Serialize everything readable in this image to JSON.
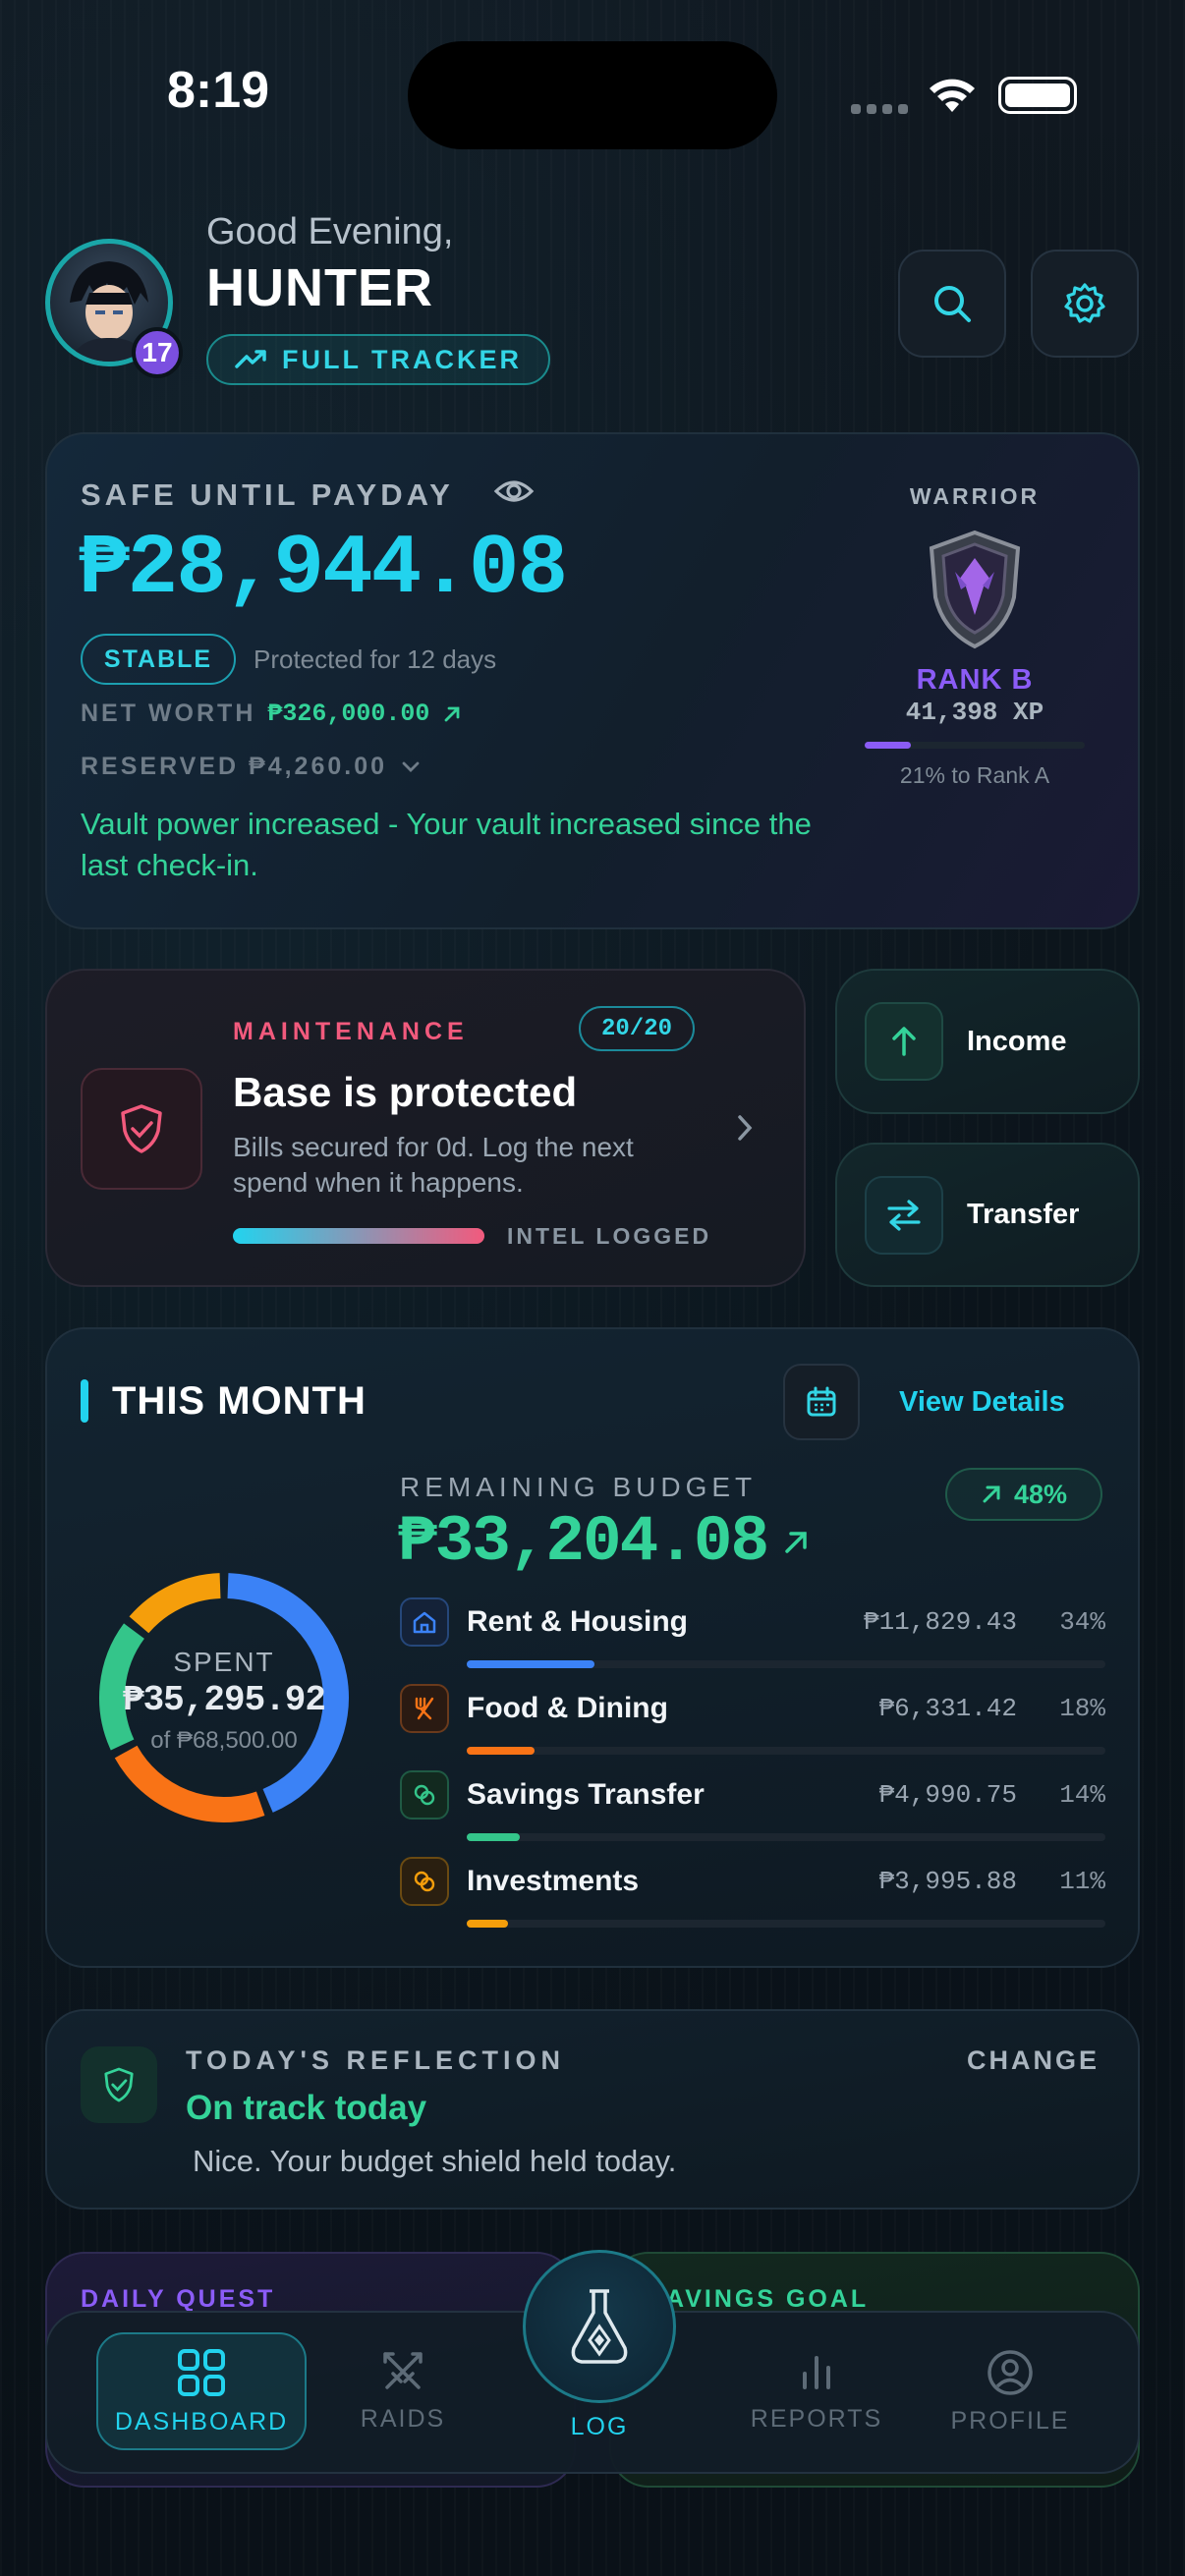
{
  "status_bar": {
    "time": "8:19"
  },
  "header": {
    "greeting": "Good Evening,",
    "name": "HUNTER",
    "level": "17",
    "tracker_label": "FULL TRACKER"
  },
  "vault": {
    "title": "SAFE UNTIL PAYDAY",
    "amount": "₱28,944.08",
    "status_badge": "STABLE",
    "protected_text": "Protected for 12 days",
    "net_worth_label": "NET WORTH",
    "net_worth_value": "₱326,000.00",
    "reserved_label": "RESERVED ₱4,260.00",
    "message": "Vault power increased - Your vault increased since the last check-in.",
    "class_label": "WARRIOR",
    "rank": "RANK B",
    "xp": "41,398 XP",
    "rank_progress_text": "21% to Rank A",
    "rank_progress": 0.21
  },
  "maintenance": {
    "label": "MAINTENANCE",
    "count": "20/20",
    "title": "Base is protected",
    "description": "Bills secured for 0d. Log the next spend when it happens.",
    "footer": "INTEL LOGGED",
    "progress": 1.0
  },
  "actions": {
    "income": "Income",
    "transfer": "Transfer"
  },
  "month": {
    "title": "THIS MONTH",
    "view_details": "View Details",
    "remaining_label": "REMAINING BUDGET",
    "remaining_value": "₱33,204.08",
    "pct_badge": "48%",
    "spent_label": "SPENT",
    "spent_value": "₱35,295.92",
    "spent_of": "of ₱68,500.00",
    "categories": [
      {
        "name": "Rent & Housing",
        "amount": "₱11,829.43",
        "pct": "34%",
        "share": 0.34,
        "color": "#3b82f6"
      },
      {
        "name": "Food & Dining",
        "amount": "₱6,331.42",
        "pct": "18%",
        "share": 0.18,
        "color": "#f97316"
      },
      {
        "name": "Savings Transfer",
        "amount": "₱4,990.75",
        "pct": "14%",
        "share": 0.14,
        "color": "#34c58a"
      },
      {
        "name": "Investments",
        "amount": "₱3,995.88",
        "pct": "11%",
        "share": 0.11,
        "color": "#f59e0b"
      }
    ]
  },
  "reflection": {
    "label": "TODAY'S REFLECTION",
    "change": "CHANGE",
    "headline": "On track today",
    "text": "Nice. Your budget shield held today."
  },
  "bottom_cards": {
    "daily_quest": "DAILY QUEST",
    "savings_goal": "AVINGS GOAL"
  },
  "nav": {
    "dashboard": "DASHBOARD",
    "raids": "RAIDS",
    "log": "LOG",
    "reports": "REPORTS",
    "profile": "PROFILE"
  },
  "colors": {
    "accent": "#33d6e6",
    "green": "#34d399",
    "purple": "#8b5cf6",
    "pink": "#f25a7d"
  }
}
